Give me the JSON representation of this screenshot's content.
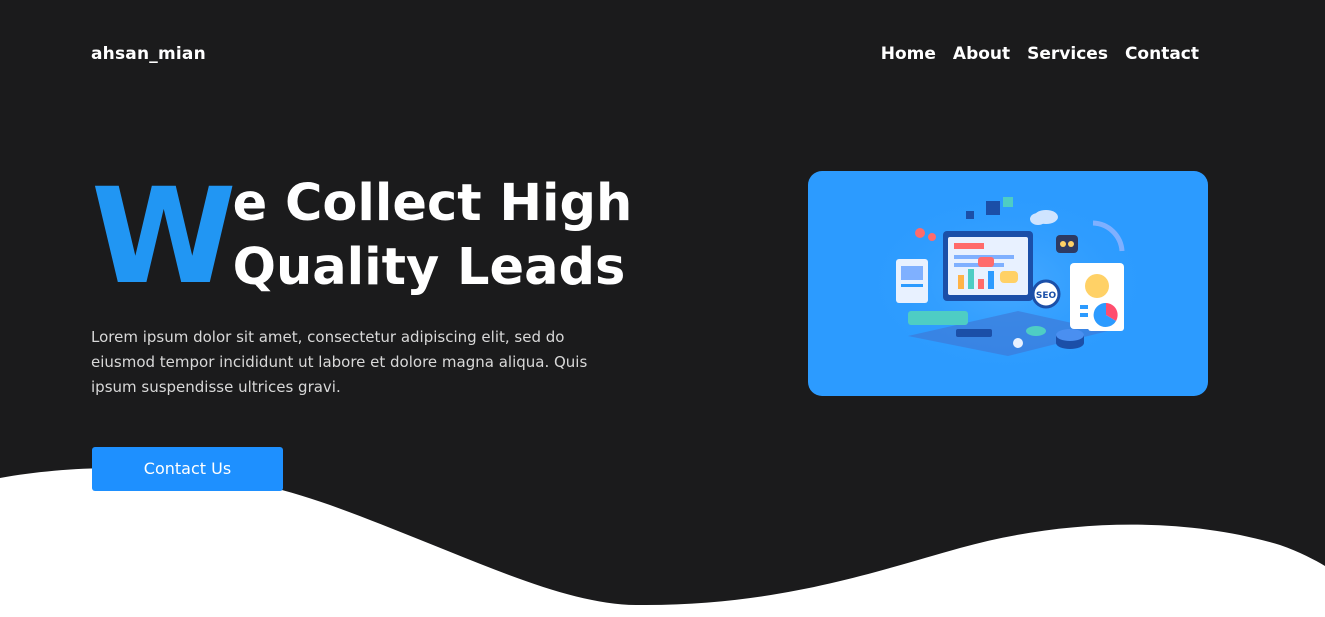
{
  "brand": {
    "logo_text": "ahsan_mian"
  },
  "nav": {
    "items": [
      "Home",
      "About",
      "Services",
      "Contact"
    ]
  },
  "hero": {
    "title_initial": "W",
    "title_line1": "e Collect High",
    "title_line2": "Quality Leads",
    "description": "Lorem ipsum dolor sit amet, consectetur adipiscing elit, sed do eiusmod tempor incididunt ut labore et dolore magna aliqua. Quis ipsum suspendisse ultrices gravi.",
    "cta_label": "Contact Us",
    "image_icon": "marketing-illustration-icon"
  },
  "colors": {
    "background": "#1b1b1c",
    "accent": "#2196f3",
    "button": "#1e90ff",
    "image_bg": "#2c9bff",
    "wave": "#ffffff"
  }
}
